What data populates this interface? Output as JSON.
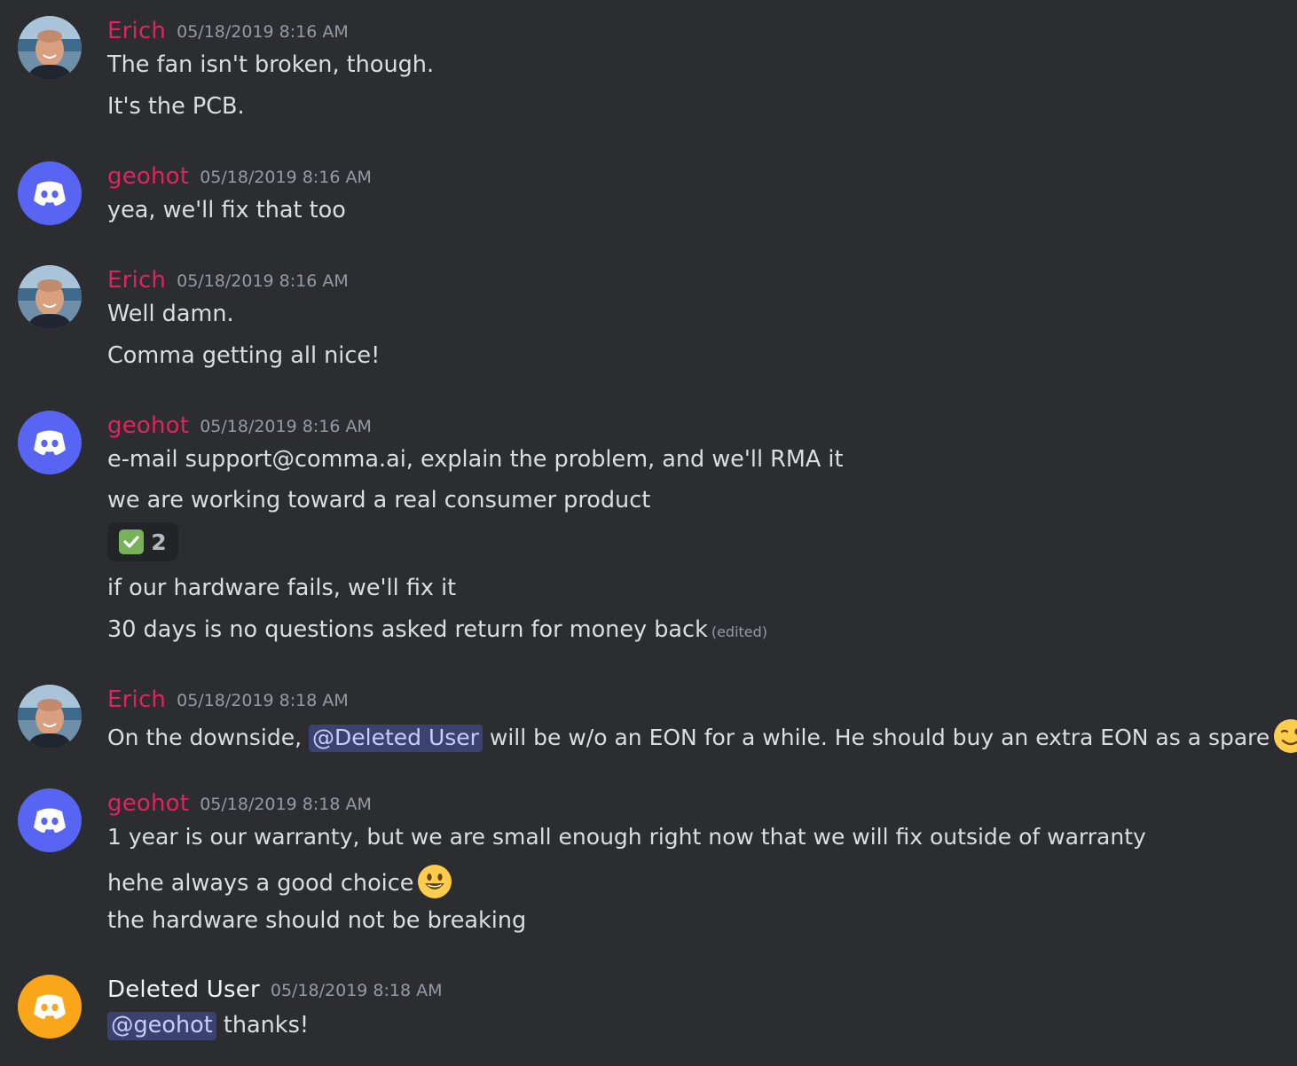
{
  "messages": [
    {
      "author": "Erich",
      "timestamp": "05/18/2019 8:16 AM",
      "lines": [
        "The fan isn't broken, though.",
        "It's the PCB."
      ]
    },
    {
      "author": "geohot",
      "timestamp": "05/18/2019 8:16 AM",
      "lines": [
        "yea, we'll fix that too"
      ]
    },
    {
      "author": "Erich",
      "timestamp": "05/18/2019 8:16 AM",
      "lines": [
        "Well damn.",
        "Comma getting all nice!"
      ]
    },
    {
      "author": "geohot",
      "timestamp": "05/18/2019 8:16 AM",
      "lines": [
        "e-mail support@comma.ai, explain the problem, and we'll RMA it",
        "we are working toward a real consumer product",
        "if our hardware fails, we'll fix it",
        "30 days is no questions asked return for money back"
      ],
      "reaction": {
        "emoji": "white-check-mark",
        "count": "2"
      },
      "edited_label": "(edited)"
    },
    {
      "author": "Erich",
      "timestamp": "05/18/2019 8:18 AM",
      "line_pre": "On the downside, ",
      "mention": "@Deleted User",
      "line_post": " will be w/o an EON for a while.  He should buy an extra EON as a spare",
      "emoji": "winking-face"
    },
    {
      "author": "geohot",
      "timestamp": "05/18/2019 8:18 AM",
      "lines": [
        "1 year is our warranty, but we are small enough right now that we will fix outside of warranty",
        "hehe always a good choice",
        "the hardware should not be breaking"
      ],
      "emoji": "smiley-face"
    },
    {
      "author": "Deleted User",
      "timestamp": "05/18/2019 8:18 AM",
      "mention": "@geohot",
      "line_post": " thanks!"
    }
  ],
  "colors": {
    "background": "#2b2d31",
    "username_red": "#e0245e",
    "username_white": "#f2f3f5",
    "discord_blurple": "#5865f2",
    "discord_orange": "#faa61a",
    "mention_bg": "#3c4270",
    "mention_text": "#c9cdfb"
  }
}
